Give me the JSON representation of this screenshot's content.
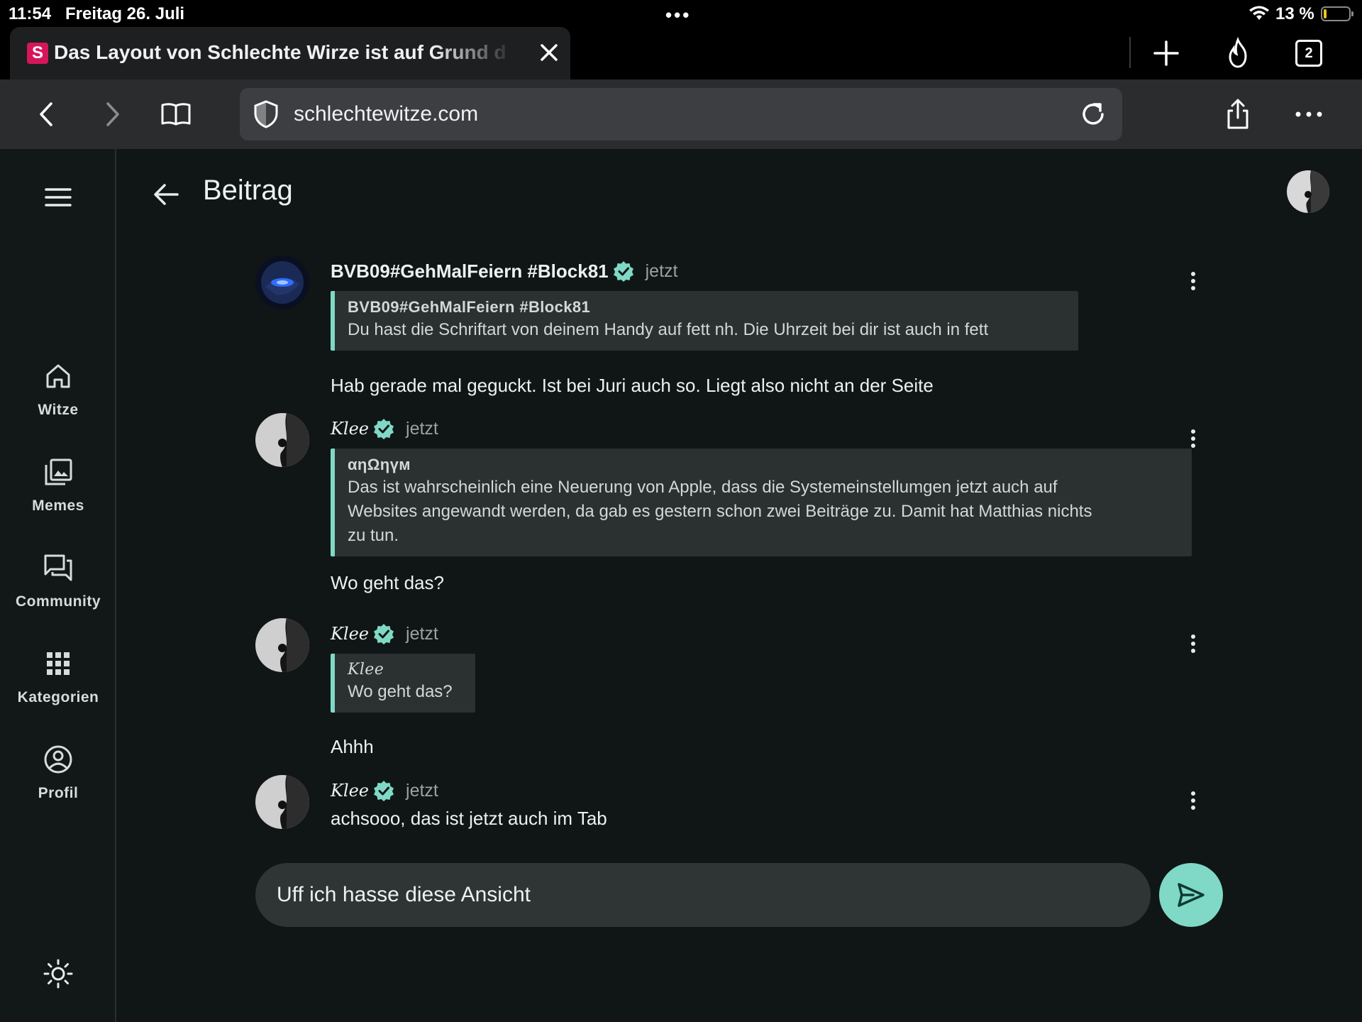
{
  "status_bar": {
    "time": "11:54",
    "date": "Freitag 26. Juli",
    "center_dots": "•••",
    "battery_percent": "13 %",
    "battery_level": 0.13
  },
  "browser": {
    "tab_title": "Das Layout von Schlechte Wirze ist auf Grund d",
    "favicon_letter": "S",
    "open_tabs": "2",
    "url": "schlechtewitze.com"
  },
  "sidebar": {
    "items": [
      {
        "label": "Witze",
        "icon": "home-icon"
      },
      {
        "label": "Memes",
        "icon": "photo-library-icon"
      },
      {
        "label": "Community",
        "icon": "forum-icon"
      },
      {
        "label": "Kategorien",
        "icon": "grid-icon"
      },
      {
        "label": "Profil",
        "icon": "account-circle-icon"
      }
    ]
  },
  "page": {
    "title": "Beitrag"
  },
  "posts": [
    {
      "author": "BVB09#GehMalFeiern #Block81",
      "time": "jetzt",
      "quote_author": "BVB09#GehMalFeiern #Block81",
      "quote_lines": [
        "Du hast die Schriftart von deinem Handy auf fett nh. Die Uhrzeit bei dir ist auch in fett"
      ],
      "text": "Hab gerade mal geguckt. Ist bei Juri auch so. Liegt also nicht an der Seite"
    },
    {
      "author": "Klee",
      "time": "jetzt",
      "quote_author": "αηΩηүм",
      "quote_lines": [
        "Das ist wahrscheinlich eine Neuerung von Apple, dass die Systemeinstellumgen jetzt auch auf",
        "Websites angewandt werden, da gab es gestern schon zwei Beiträge zu. Damit hat Matthias nichts",
        "zu tun."
      ],
      "text": "Wo geht das?"
    },
    {
      "author": "Klee",
      "time": "jetzt",
      "quote_author": "Klee",
      "quote_lines": [
        "Wo geht das?"
      ],
      "text": "Ahhh"
    },
    {
      "author": "Klee",
      "time": "jetzt",
      "text": "achsooo, das ist jetzt auch im Tab"
    }
  ],
  "composer": {
    "value": "Uff ich hasse diese Ansicht"
  },
  "colors": {
    "accent": "#7fd9c6",
    "background": "#0f1615",
    "quote_background": "#2a3130",
    "favicon": "#d6165a"
  }
}
